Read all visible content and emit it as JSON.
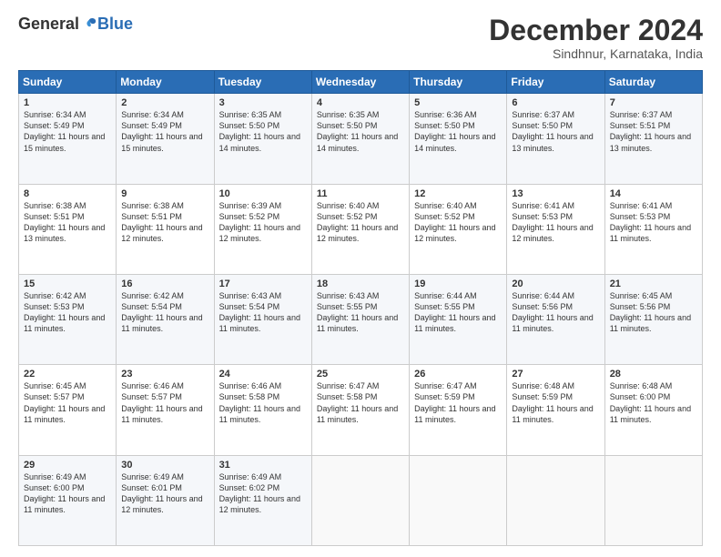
{
  "logo": {
    "general": "General",
    "blue": "Blue"
  },
  "title": "December 2024",
  "subtitle": "Sindhnur, Karnataka, India",
  "days_header": [
    "Sunday",
    "Monday",
    "Tuesday",
    "Wednesday",
    "Thursday",
    "Friday",
    "Saturday"
  ],
  "weeks": [
    [
      {
        "day": "1",
        "info": "Sunrise: 6:34 AM\nSunset: 5:49 PM\nDaylight: 11 hours and 15 minutes."
      },
      {
        "day": "2",
        "info": "Sunrise: 6:34 AM\nSunset: 5:49 PM\nDaylight: 11 hours and 15 minutes."
      },
      {
        "day": "3",
        "info": "Sunrise: 6:35 AM\nSunset: 5:50 PM\nDaylight: 11 hours and 14 minutes."
      },
      {
        "day": "4",
        "info": "Sunrise: 6:35 AM\nSunset: 5:50 PM\nDaylight: 11 hours and 14 minutes."
      },
      {
        "day": "5",
        "info": "Sunrise: 6:36 AM\nSunset: 5:50 PM\nDaylight: 11 hours and 14 minutes."
      },
      {
        "day": "6",
        "info": "Sunrise: 6:37 AM\nSunset: 5:50 PM\nDaylight: 11 hours and 13 minutes."
      },
      {
        "day": "7",
        "info": "Sunrise: 6:37 AM\nSunset: 5:51 PM\nDaylight: 11 hours and 13 minutes."
      }
    ],
    [
      {
        "day": "8",
        "info": "Sunrise: 6:38 AM\nSunset: 5:51 PM\nDaylight: 11 hours and 13 minutes."
      },
      {
        "day": "9",
        "info": "Sunrise: 6:38 AM\nSunset: 5:51 PM\nDaylight: 11 hours and 12 minutes."
      },
      {
        "day": "10",
        "info": "Sunrise: 6:39 AM\nSunset: 5:52 PM\nDaylight: 11 hours and 12 minutes."
      },
      {
        "day": "11",
        "info": "Sunrise: 6:40 AM\nSunset: 5:52 PM\nDaylight: 11 hours and 12 minutes."
      },
      {
        "day": "12",
        "info": "Sunrise: 6:40 AM\nSunset: 5:52 PM\nDaylight: 11 hours and 12 minutes."
      },
      {
        "day": "13",
        "info": "Sunrise: 6:41 AM\nSunset: 5:53 PM\nDaylight: 11 hours and 12 minutes."
      },
      {
        "day": "14",
        "info": "Sunrise: 6:41 AM\nSunset: 5:53 PM\nDaylight: 11 hours and 11 minutes."
      }
    ],
    [
      {
        "day": "15",
        "info": "Sunrise: 6:42 AM\nSunset: 5:53 PM\nDaylight: 11 hours and 11 minutes."
      },
      {
        "day": "16",
        "info": "Sunrise: 6:42 AM\nSunset: 5:54 PM\nDaylight: 11 hours and 11 minutes."
      },
      {
        "day": "17",
        "info": "Sunrise: 6:43 AM\nSunset: 5:54 PM\nDaylight: 11 hours and 11 minutes."
      },
      {
        "day": "18",
        "info": "Sunrise: 6:43 AM\nSunset: 5:55 PM\nDaylight: 11 hours and 11 minutes."
      },
      {
        "day": "19",
        "info": "Sunrise: 6:44 AM\nSunset: 5:55 PM\nDaylight: 11 hours and 11 minutes."
      },
      {
        "day": "20",
        "info": "Sunrise: 6:44 AM\nSunset: 5:56 PM\nDaylight: 11 hours and 11 minutes."
      },
      {
        "day": "21",
        "info": "Sunrise: 6:45 AM\nSunset: 5:56 PM\nDaylight: 11 hours and 11 minutes."
      }
    ],
    [
      {
        "day": "22",
        "info": "Sunrise: 6:45 AM\nSunset: 5:57 PM\nDaylight: 11 hours and 11 minutes."
      },
      {
        "day": "23",
        "info": "Sunrise: 6:46 AM\nSunset: 5:57 PM\nDaylight: 11 hours and 11 minutes."
      },
      {
        "day": "24",
        "info": "Sunrise: 6:46 AM\nSunset: 5:58 PM\nDaylight: 11 hours and 11 minutes."
      },
      {
        "day": "25",
        "info": "Sunrise: 6:47 AM\nSunset: 5:58 PM\nDaylight: 11 hours and 11 minutes."
      },
      {
        "day": "26",
        "info": "Sunrise: 6:47 AM\nSunset: 5:59 PM\nDaylight: 11 hours and 11 minutes."
      },
      {
        "day": "27",
        "info": "Sunrise: 6:48 AM\nSunset: 5:59 PM\nDaylight: 11 hours and 11 minutes."
      },
      {
        "day": "28",
        "info": "Sunrise: 6:48 AM\nSunset: 6:00 PM\nDaylight: 11 hours and 11 minutes."
      }
    ],
    [
      {
        "day": "29",
        "info": "Sunrise: 6:49 AM\nSunset: 6:00 PM\nDaylight: 11 hours and 11 minutes."
      },
      {
        "day": "30",
        "info": "Sunrise: 6:49 AM\nSunset: 6:01 PM\nDaylight: 11 hours and 12 minutes."
      },
      {
        "day": "31",
        "info": "Sunrise: 6:49 AM\nSunset: 6:02 PM\nDaylight: 11 hours and 12 minutes."
      },
      {
        "day": "",
        "info": ""
      },
      {
        "day": "",
        "info": ""
      },
      {
        "day": "",
        "info": ""
      },
      {
        "day": "",
        "info": ""
      }
    ]
  ]
}
